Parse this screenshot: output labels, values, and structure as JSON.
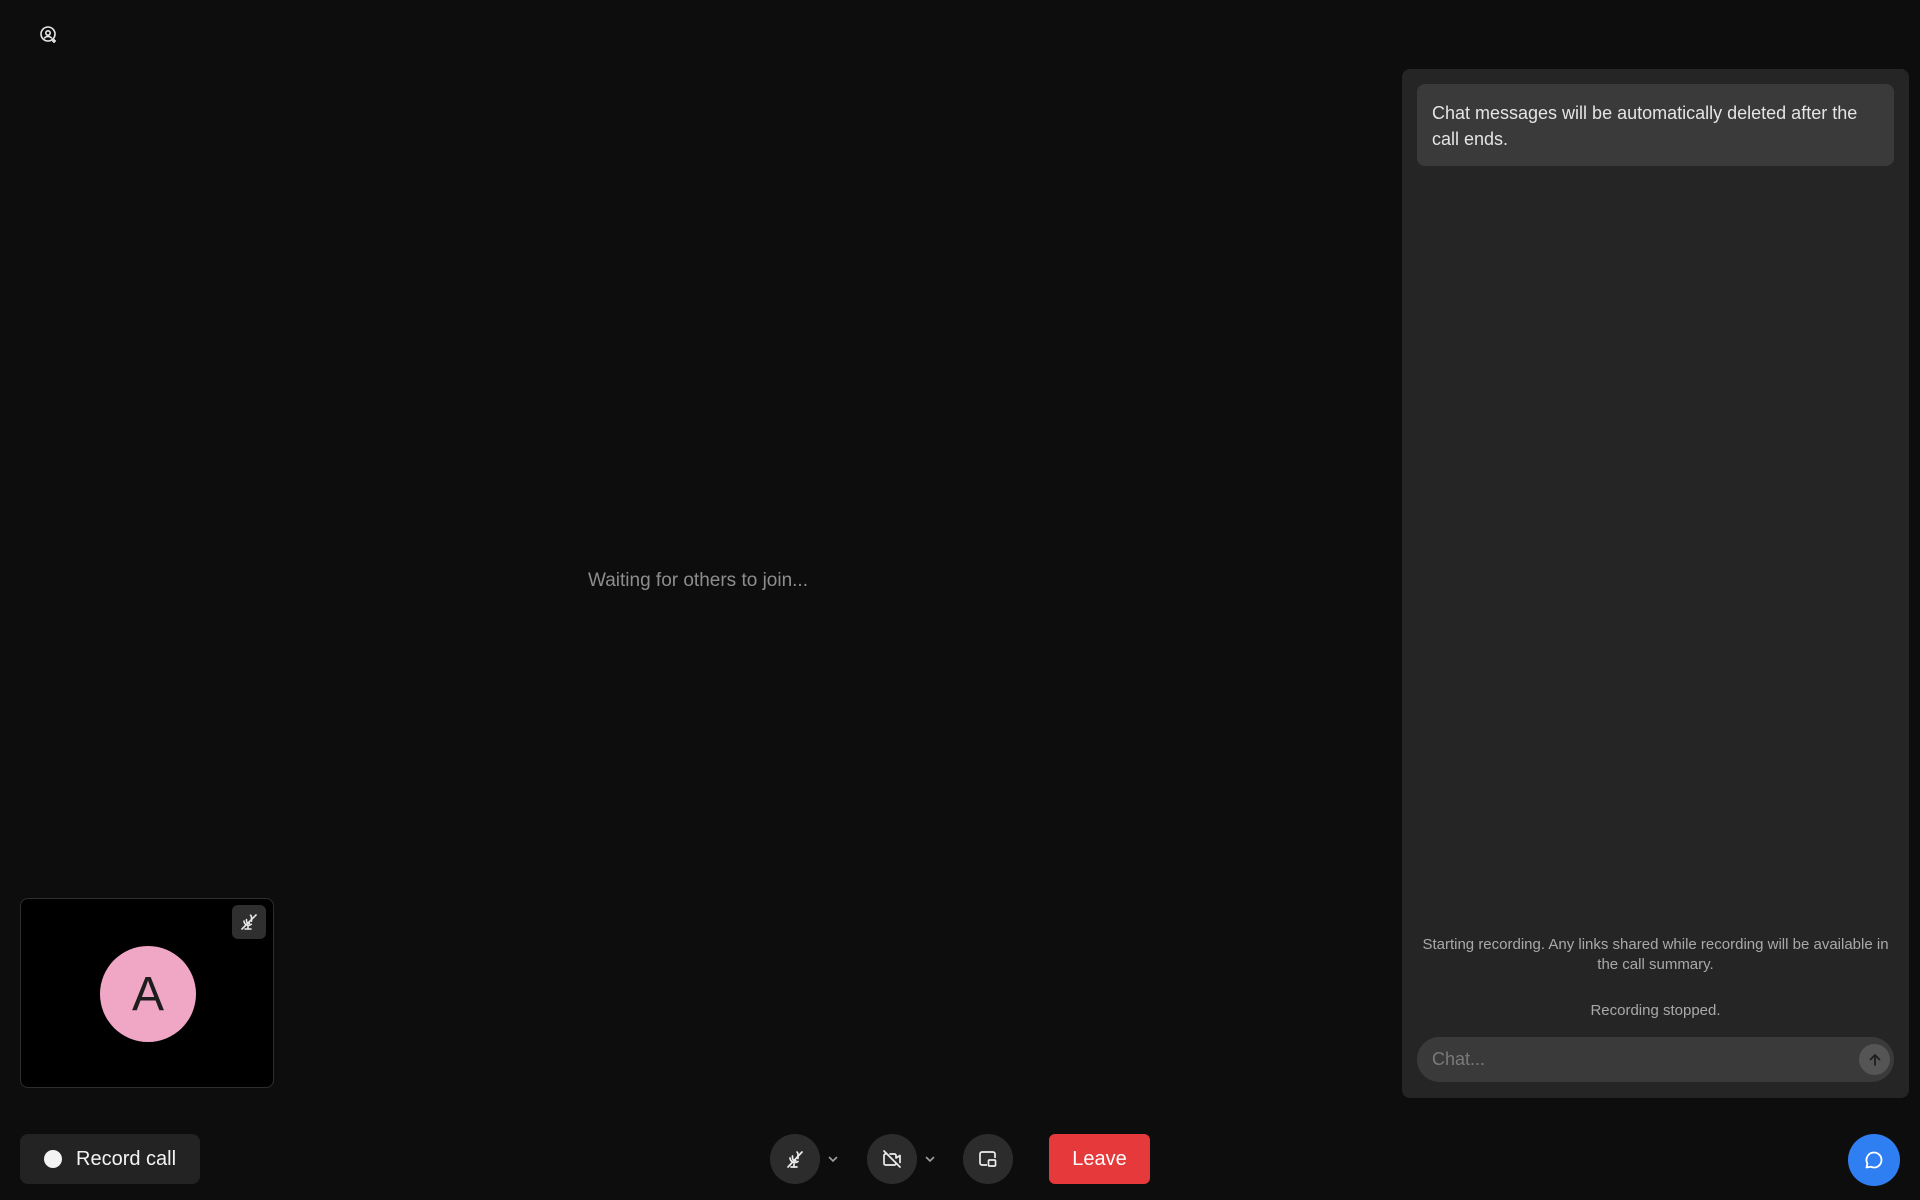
{
  "main": {
    "waiting_text": "Waiting for others to join...",
    "top_icon": "user-add-icon"
  },
  "self_view": {
    "avatar_initial": "A",
    "avatar_color": "#f0a6c5",
    "mic_status_icon": "mic-off-icon"
  },
  "controls": {
    "record_label": "Record call",
    "mic_icon": "mic-off-icon",
    "camera_icon": "video-off-icon",
    "screen_share_icon": "screen-share-icon",
    "leave_label": "Leave",
    "leave_color": "#e6393b",
    "chat_icon": "chat-bubble-icon",
    "chat_fab_color": "#2f7ff3"
  },
  "chat": {
    "notice": "Chat messages will be automatically deleted after the call ends.",
    "system_messages": [
      "Starting recording. Any links shared while recording will be available in the call summary.",
      "Recording stopped."
    ],
    "input_placeholder": "Chat...",
    "input_value": "",
    "send_icon": "arrow-up-icon"
  }
}
